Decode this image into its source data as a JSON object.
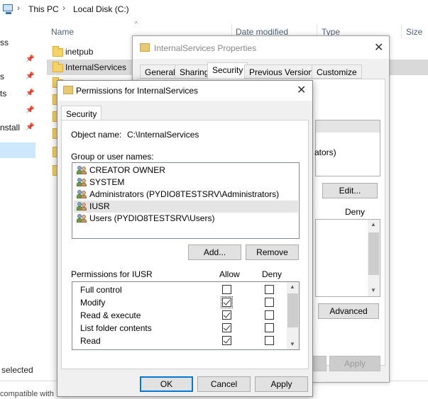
{
  "explorer": {
    "breadcrumb": [
      "This PC",
      "Local Disk (C:)"
    ],
    "columns": [
      "Name",
      "Date modified",
      "Type",
      "Size"
    ],
    "nav_items": [
      "ss",
      "s",
      "ts",
      "",
      "nstall"
    ],
    "files": [
      "inetpub",
      "InternalServices",
      "",
      "",
      "",
      "",
      "",
      ""
    ],
    "status": "selected",
    "bottom_text": "compatible with ..."
  },
  "properties": {
    "title": "InternalServices Properties",
    "tabs": [
      "General",
      "Sharing",
      "Security",
      "Previous Versions",
      "Customize"
    ],
    "active_tab": "Security",
    "partial_text": "ators)",
    "edit_button": "Edit...",
    "deny_label": "Deny",
    "advanced_button": "Advanced",
    "apply_button": "Apply"
  },
  "permissions": {
    "title": "Permissions for InternalServices",
    "tab": "Security",
    "object_name_label": "Object name:",
    "object_name_value": "C:\\InternalServices",
    "group_label": "Group or user names:",
    "users": [
      {
        "name": "CREATOR OWNER",
        "selected": false
      },
      {
        "name": "SYSTEM",
        "selected": false
      },
      {
        "name": "Administrators (PYDIO8TESTSRV\\Administrators)",
        "selected": false
      },
      {
        "name": "IUSR",
        "selected": true
      },
      {
        "name": "Users (PYDIO8TESTSRV\\Users)",
        "selected": false
      }
    ],
    "add_button": "Add...",
    "remove_button": "Remove",
    "permissions_label": "Permissions for IUSR",
    "allow_label": "Allow",
    "deny_label": "Deny",
    "rows": [
      {
        "name": "Full control",
        "allow": false,
        "deny": false
      },
      {
        "name": "Modify",
        "allow": true,
        "deny": false
      },
      {
        "name": "Read & execute",
        "allow": true,
        "deny": false
      },
      {
        "name": "List folder contents",
        "allow": true,
        "deny": false
      },
      {
        "name": "Read",
        "allow": true,
        "deny": false
      }
    ],
    "ok_button": "OK",
    "cancel_button": "Cancel",
    "apply_button": "Apply"
  },
  "colors": {
    "selection": "#cce8ff",
    "dialog_bg": "#f0f0f0",
    "focus_border": "#0078d7"
  }
}
